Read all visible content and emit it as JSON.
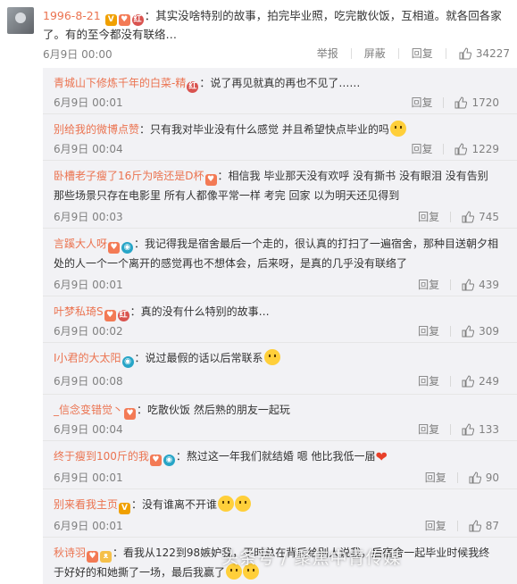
{
  "main_comment": {
    "username": "1996-8-21",
    "text": "：其实没啥特别的故事，拍完毕业照，吃完散伙饭，互相道。就各回各家了。有的至今都没有联络…",
    "time": "6月9日 00:00",
    "report": "举报",
    "block": "屏蔽",
    "reply": "回复",
    "likes": "34227"
  },
  "replies": [
    {
      "username": "青城山下修炼千年的白菜-精",
      "text": "：说了再见就真的再也不见了……",
      "time": "6月9日 00:01",
      "reply": "回复",
      "likes": "1720"
    },
    {
      "username": "别给我的微博点赞",
      "text": "：只有我对毕业没有什么感觉 并且希望快点毕业的吗",
      "time": "6月9日 00:04",
      "reply": "回复",
      "likes": "1229"
    },
    {
      "username": "卧槽老子瘦了16斤为啥还是D杯",
      "text": "：相信我 毕业那天没有欢呼 没有撕书 没有眼泪 没有告别 那些场景只存在电影里 所有人都像平常一样 考完 回家 以为明天还见得到",
      "time": "6月9日 00:03",
      "reply": "回复",
      "likes": "745"
    },
    {
      "username": "言蹊大人呀",
      "text": "：我记得我是宿舍最后一个走的，很认真的打扫了一遍宿舍，那种目送朝夕相处的人一个一个离开的感觉再也不想体会，后来呀，是真的几乎没有联络了",
      "time": "6月9日 00:01",
      "reply": "回复",
      "likes": "439"
    },
    {
      "username": "叶梦私琦S",
      "text": "：真的没有什么特别的故事…",
      "time": "6月9日 00:02",
      "reply": "回复",
      "likes": "309"
    },
    {
      "username": "I小君的大太阳",
      "text": "：说过最假的话以后常联系",
      "time": "6月9日 00:08",
      "reply": "回复",
      "likes": "249"
    },
    {
      "username": "_信念变错觉丶",
      "text": "：吃散伙饭 然后熟的朋友一起玩",
      "time": "6月9日 00:04",
      "reply": "回复",
      "likes": "133"
    },
    {
      "username": "终于瘦到100斤的我",
      "text": "：熬过这一年我们就结婚 嗯 他比我低一届",
      "time": "6月9日 00:01",
      "reply": "回复",
      "likes": "90"
    },
    {
      "username": "别来看我主页",
      "text": "：没有谁离不开谁",
      "time": "6月9日 00:01",
      "reply": "回复",
      "likes": "87"
    },
    {
      "username": "秋诗羽",
      "text": "：看我从122到98嫉妒我，平时总在背后给别人说我，后宿舍一起毕业时候我终于好好的和她撕了一场，最后我赢了",
      "time": "",
      "reply": "",
      "likes": ""
    }
  ],
  "watermark": "头条号 / 聚焦中青传媒",
  "colors": {
    "username": "#eb7350",
    "meta": "#808080",
    "reply_bg": "#f2f2f5"
  }
}
